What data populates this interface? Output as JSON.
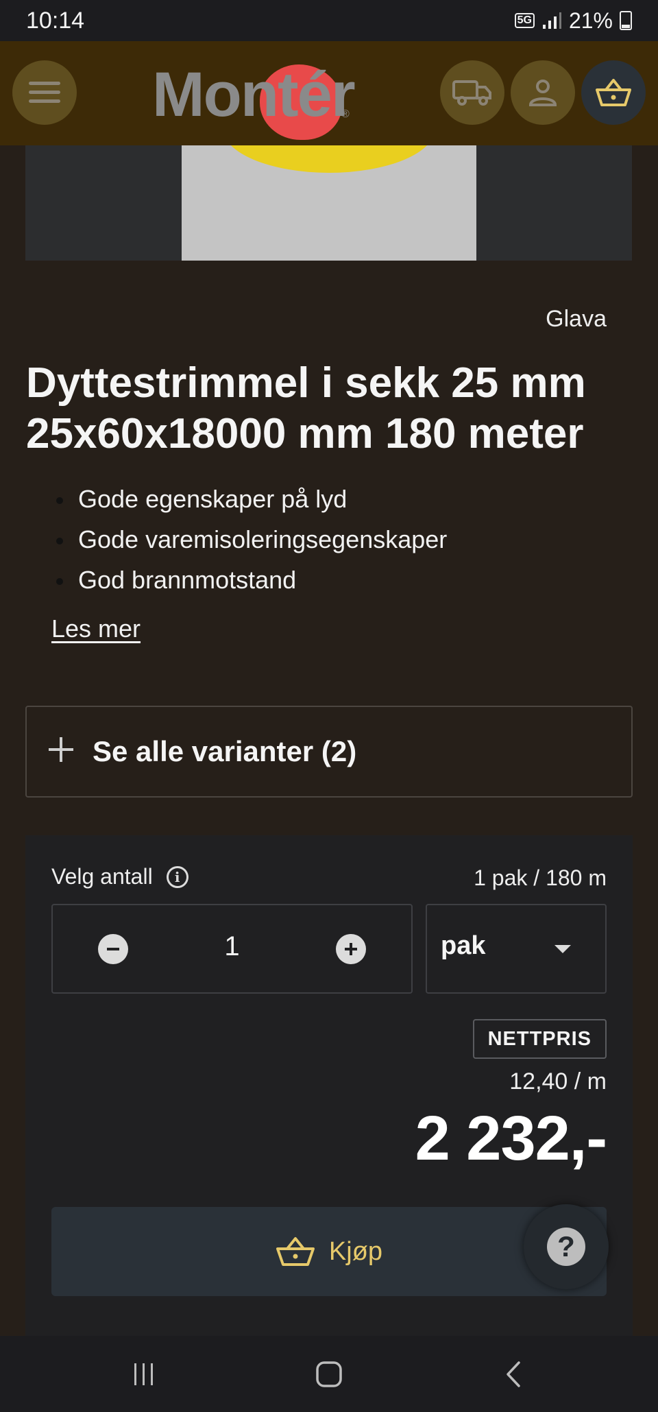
{
  "status_bar": {
    "time": "10:14",
    "network": "5G",
    "battery": "21%"
  },
  "header": {
    "logo_text": "Montér",
    "logo_mark": "®",
    "icons": [
      "menu-icon",
      "truck-icon",
      "user-icon",
      "basket-icon"
    ],
    "colors": {
      "bg": "#3d2a07",
      "button_bg": "#5f4e1f",
      "basket_bg": "#2a3138",
      "logo_blob": "#e84a4a"
    }
  },
  "product": {
    "brand": "Glava",
    "title": "Dyttestrimmel i sekk 25 mm 25x60x18000 mm 180 meter",
    "bullets": [
      "Gode egenskaper på lyd",
      "Gode varemisoleringsegenskaper",
      "God brannmotstand"
    ],
    "read_more": "Les mer",
    "variants_label": "Se alle varianter (2)"
  },
  "purchase": {
    "quantity_label": "Velg antall",
    "pack_info": "1 pak / 180 m",
    "quantity": "1",
    "unit": "pak",
    "price_badge": "NETTPRIS",
    "unit_price": "12,40 / m",
    "price": "2 232,-",
    "buy_label": "Kjøp",
    "help_symbol": "?",
    "accent_color": "#e6c96a"
  },
  "nav_bar": {
    "icons": [
      "recent-apps-icon",
      "home-icon",
      "back-icon"
    ]
  }
}
